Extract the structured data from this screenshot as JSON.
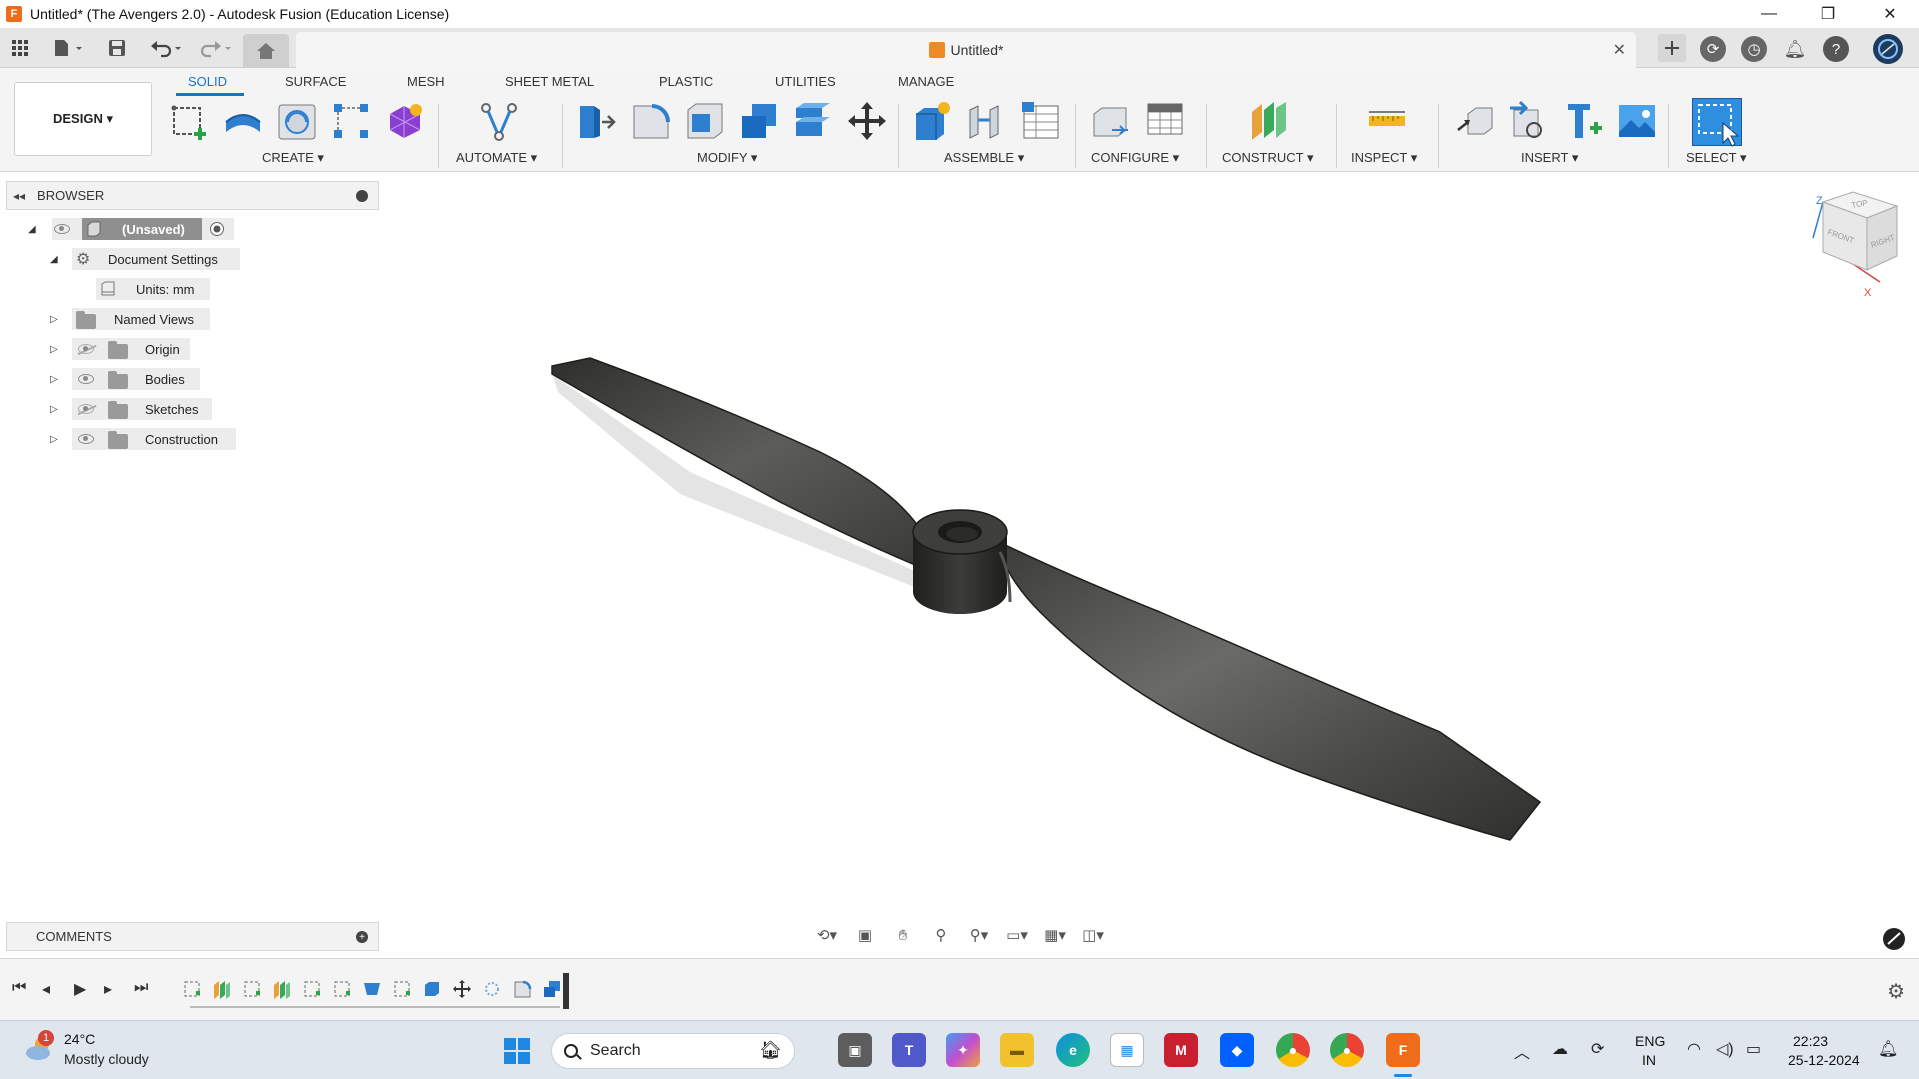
{
  "window": {
    "title": "Untitled* (The Avengers 2.0) - Autodesk Fusion (Education License)",
    "app_logo": "F",
    "minimize": "—",
    "maximize": "❐",
    "close": "✕"
  },
  "appbar": {
    "doc_tab_title": "Untitled*",
    "tab_close": "✕"
  },
  "toolbar": {
    "workspace": "DESIGN ▾",
    "tabs": [
      "SOLID",
      "SURFACE",
      "MESH",
      "SHEET METAL",
      "PLASTIC",
      "UTILITIES",
      "MANAGE"
    ],
    "groups": {
      "create": "CREATE ▾",
      "automate": "AUTOMATE ▾",
      "modify": "MODIFY ▾",
      "assemble": "ASSEMBLE ▾",
      "configure": "CONFIGURE ▾",
      "construct": "CONSTRUCT ▾",
      "inspect": "INSPECT ▾",
      "insert": "INSERT ▾",
      "select": "SELECT ▾"
    }
  },
  "browser": {
    "title": "BROWSER",
    "root": "(Unsaved)",
    "document_settings": "Document Settings",
    "units": "Units: mm",
    "named_views": "Named Views",
    "origin": "Origin",
    "bodies": "Bodies",
    "sketches": "Sketches",
    "construction": "Construction"
  },
  "comments": {
    "title": "COMMENTS"
  },
  "viewcube": {
    "top": "TOP",
    "front": "FRONT",
    "right": "RIGHT",
    "z": "Z",
    "x": "X"
  },
  "taskbar": {
    "weather_temp": "24°C",
    "weather_desc": "Mostly cloudy",
    "weather_badge": "1",
    "search_label": "Search",
    "lang_1": "ENG",
    "lang_2": "IN",
    "time": "22:23",
    "date": "25-12-2024"
  },
  "colors": {
    "accent": "#1a73c8",
    "fusion_orange": "#ef6c1a",
    "body_dark": "#3a3a38"
  }
}
